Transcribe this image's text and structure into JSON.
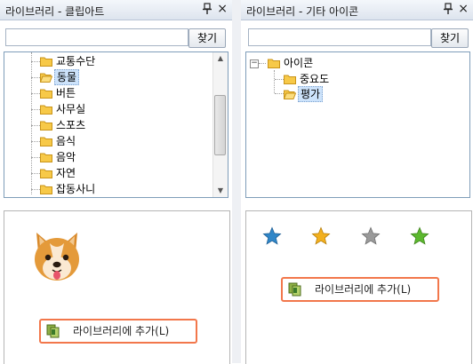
{
  "left": {
    "title": "라이브러리 - 클립아트",
    "search_placeholder": "",
    "find_label": "찾기",
    "tree_items": [
      "교통수단",
      "동물",
      "버튼",
      "사무실",
      "스포츠",
      "음식",
      "음악",
      "자연",
      "잡동사니"
    ],
    "selected_item": "동물",
    "add_label": "라이브러리에 추가(L)"
  },
  "right": {
    "title": "라이브러리 - 기타 아이콘",
    "search_placeholder": "",
    "find_label": "찾기",
    "tree_root": "아이콘",
    "tree_children": [
      "중요도",
      "평가"
    ],
    "selected_item": "평가",
    "add_label": "라이브러리에 추가(L)"
  },
  "icons": {
    "pin": "pin-icon",
    "close": "close-icon",
    "folder": "folder-icon",
    "open_folder": "open-folder-icon",
    "preview": "dog-face-icon",
    "add": "library-add-icon",
    "stars": [
      "blue-star-icon",
      "gold-star-icon",
      "gray-star-icon",
      "green-star-icon"
    ]
  },
  "colors": {
    "highlight_border": "#f2774b",
    "selection": "#cde3fb",
    "star_blue": "#2f86c8",
    "star_gold": "#f2b01e",
    "star_gray": "#9a9a9a",
    "star_green": "#5cb82e"
  }
}
